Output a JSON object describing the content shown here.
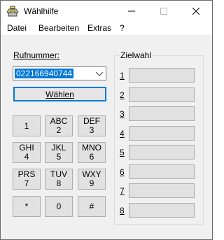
{
  "window": {
    "title": "Wählhilfe",
    "icon": "phone-dialer-icon"
  },
  "menu": [
    {
      "label": "Datei"
    },
    {
      "label": "Bearbeiten"
    },
    {
      "label": "Extras"
    },
    {
      "label": "?"
    }
  ],
  "phone": {
    "label": "Rufnummer:",
    "value": "022166940744"
  },
  "dial_button": "Wählen",
  "keypad": [
    {
      "top": "1",
      "bottom": ""
    },
    {
      "top": "ABC",
      "bottom": "2"
    },
    {
      "top": "DEF",
      "bottom": "3"
    },
    {
      "top": "GHI",
      "bottom": "4"
    },
    {
      "top": "JKL",
      "bottom": "5"
    },
    {
      "top": "MNO",
      "bottom": "6"
    },
    {
      "top": "PRS",
      "bottom": "7"
    },
    {
      "top": "TUV",
      "bottom": "8"
    },
    {
      "top": "WXY",
      "bottom": "9"
    },
    {
      "top": "*",
      "bottom": ""
    },
    {
      "top": "0",
      "bottom": ""
    },
    {
      "top": "#",
      "bottom": ""
    }
  ],
  "speed_dial": {
    "label": "Zielwahl",
    "entries": [
      {
        "number": "1",
        "value": ""
      },
      {
        "number": "2",
        "value": ""
      },
      {
        "number": "3",
        "value": ""
      },
      {
        "number": "4",
        "value": ""
      },
      {
        "number": "5",
        "value": ""
      },
      {
        "number": "6",
        "value": ""
      },
      {
        "number": "7",
        "value": ""
      },
      {
        "number": "8",
        "value": ""
      }
    ]
  }
}
